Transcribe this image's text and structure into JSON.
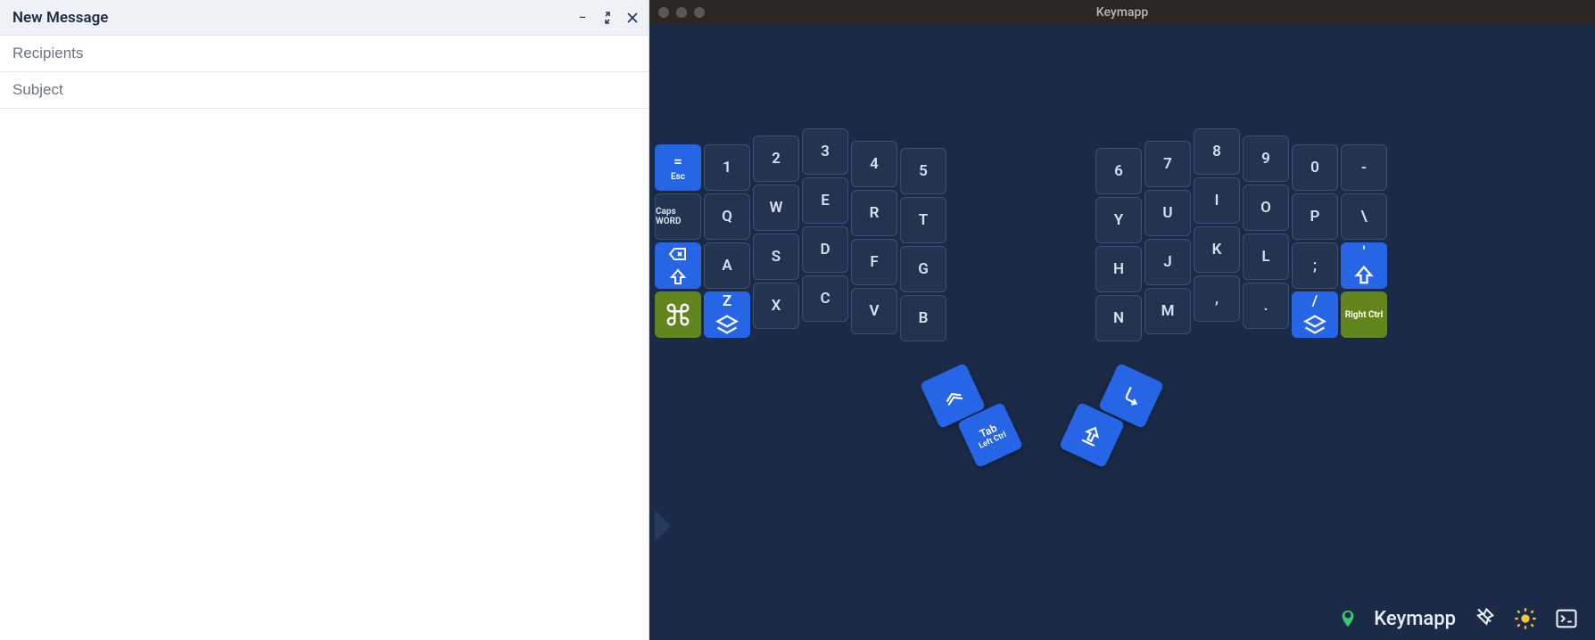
{
  "compose": {
    "title": "New Message",
    "recipients_placeholder": "Recipients",
    "subject_placeholder": "Subject"
  },
  "keymapp": {
    "app_title": "Keymapp",
    "footer_label": "Keymapp",
    "left_cols": [
      [
        {
          "id": "esc",
          "top": "=",
          "sub": "Esc",
          "style": "blue stack"
        },
        {
          "id": "caps-word",
          "label": "Caps WORD",
          "style": "tiny"
        },
        {
          "id": "shift-bksp",
          "icon": "shift",
          "top_icon": "bksp",
          "style": "blue stack"
        },
        {
          "id": "cmd",
          "icon": "cmd",
          "style": "green"
        }
      ],
      [
        {
          "id": "1",
          "label": "1"
        },
        {
          "id": "q",
          "label": "Q"
        },
        {
          "id": "a",
          "label": "A"
        },
        {
          "id": "z",
          "top": "Z",
          "icon": "layer",
          "style": "blue stack"
        }
      ],
      [
        {
          "id": "2",
          "label": "2"
        },
        {
          "id": "w",
          "label": "W"
        },
        {
          "id": "s",
          "label": "S"
        },
        {
          "id": "x",
          "label": "X"
        }
      ],
      [
        {
          "id": "3",
          "label": "3"
        },
        {
          "id": "e",
          "label": "E"
        },
        {
          "id": "d",
          "label": "D"
        },
        {
          "id": "c",
          "label": "C"
        }
      ],
      [
        {
          "id": "4",
          "label": "4"
        },
        {
          "id": "r",
          "label": "R"
        },
        {
          "id": "f",
          "label": "F"
        },
        {
          "id": "v",
          "label": "V"
        }
      ],
      [
        {
          "id": "5",
          "label": "5"
        },
        {
          "id": "t",
          "label": "T"
        },
        {
          "id": "g",
          "label": "G"
        },
        {
          "id": "b",
          "label": "B"
        }
      ]
    ],
    "right_cols": [
      [
        {
          "id": "6",
          "label": "6"
        },
        {
          "id": "y",
          "label": "Y"
        },
        {
          "id": "h",
          "label": "H"
        },
        {
          "id": "n",
          "label": "N"
        }
      ],
      [
        {
          "id": "7",
          "label": "7"
        },
        {
          "id": "u",
          "label": "U"
        },
        {
          "id": "j",
          "label": "J"
        },
        {
          "id": "m",
          "label": "M"
        }
      ],
      [
        {
          "id": "8",
          "label": "8"
        },
        {
          "id": "i",
          "label": "I"
        },
        {
          "id": "k",
          "label": "K"
        },
        {
          "id": "comma",
          "label": ","
        }
      ],
      [
        {
          "id": "9",
          "label": "9"
        },
        {
          "id": "o",
          "label": "O"
        },
        {
          "id": "l",
          "label": "L"
        },
        {
          "id": "period",
          "label": "."
        }
      ],
      [
        {
          "id": "0",
          "label": "0"
        },
        {
          "id": "p",
          "label": "P"
        },
        {
          "id": "semicolon",
          "label": ";"
        },
        {
          "id": "slash",
          "top": "/",
          "icon": "layer",
          "style": "blue stack"
        }
      ],
      [
        {
          "id": "minus",
          "label": "-"
        },
        {
          "id": "backslash",
          "label": "\\"
        },
        {
          "id": "quote",
          "top": "'",
          "icon": "shift",
          "style": "blue stack"
        },
        {
          "id": "right-ctrl",
          "label": "Right Ctrl",
          "style": "green tiny"
        }
      ]
    ],
    "left_thumbs": [
      {
        "id": "lt-inner",
        "icon": "layer-stack"
      },
      {
        "id": "lt-outer",
        "top": "Tab",
        "sub": "Left Ctrl"
      }
    ],
    "right_thumbs": [
      {
        "id": "rt-inner",
        "icon": "enter"
      },
      {
        "id": "rt-outer",
        "icon": "shift-stack"
      }
    ],
    "column_y_offsets": [
      0,
      0,
      -10,
      -18,
      -4,
      4
    ],
    "colors": {
      "bg": "#1b2b47",
      "key_bg": "#233450",
      "key_border": "#3a5175",
      "blue": "#2665e6",
      "green": "#62861e"
    }
  }
}
